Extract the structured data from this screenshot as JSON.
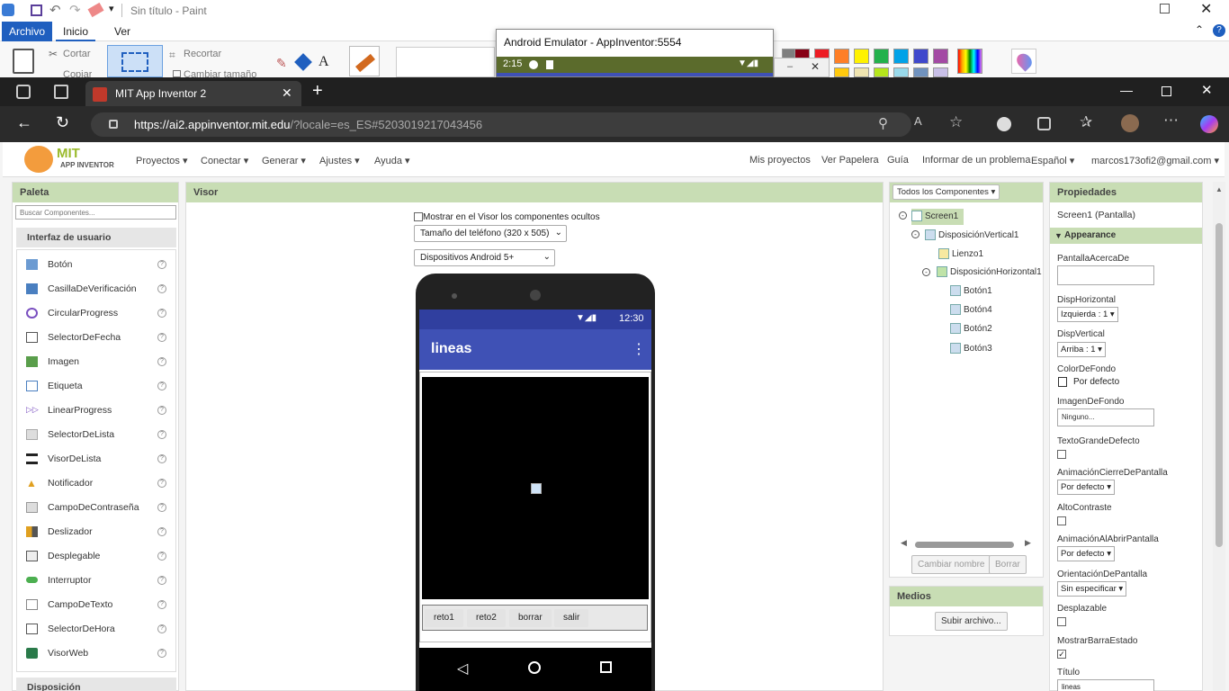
{
  "paint": {
    "title": "Sin título - Paint",
    "tabs": [
      "Archivo",
      "Inicio",
      "Ver"
    ],
    "tools": {
      "cut": "Cortar",
      "copy": "Copiar",
      "crop": "Recortar",
      "resize": "Cambiar tamaño"
    }
  },
  "emulator": {
    "title": "Android Emulator - AppInventor:5554",
    "time": "2:15"
  },
  "browser": {
    "tab_title": "MIT App Inventor 2",
    "url_host": "https://ai2.appinventor.mit.edu",
    "url_rest": "/?locale=es_ES#5203019217043456"
  },
  "nav": {
    "logo_line1": "MIT",
    "logo_line2": "APP INVENTOR",
    "menus": [
      "Proyectos ▾",
      "Conectar ▾",
      "Generar ▾",
      "Ajustes ▾",
      "Ayuda ▾"
    ],
    "right": [
      "Mis proyectos",
      "Ver Papelera",
      "Guía",
      "Informar de un problema",
      "Español ▾",
      "marcos173ofi2@gmail.com ▾"
    ]
  },
  "palette": {
    "title": "Paleta",
    "search_placeholder": "Buscar Componentes...",
    "section": "Interfaz de usuario",
    "items": [
      "Botón",
      "CasillaDeVerificación",
      "CircularProgress",
      "SelectorDeFecha",
      "Imagen",
      "Etiqueta",
      "LinearProgress",
      "SelectorDeLista",
      "VisorDeLista",
      "Notificador",
      "CampoDeContraseña",
      "Deslizador",
      "Desplegable",
      "Interruptor",
      "CampoDeTexto",
      "SelectorDeHora",
      "VisorWeb"
    ],
    "help_glyph": "?",
    "section2": "Disposición"
  },
  "viewer": {
    "title": "Visor",
    "show_hidden": "Mostrar en el Visor los componentes ocultos",
    "phone_size": "Tamaño del teléfono (320 x 505)",
    "android_version": "Dispositivos Android 5+",
    "status_time": "12:30",
    "app_title": "lineas",
    "buttons": [
      "reto1",
      "reto2",
      "borrar",
      "salir"
    ]
  },
  "components": {
    "title": "Todos los Componentes ▾",
    "tree": [
      "Screen1",
      "DisposiciónVertical1",
      "Lienzo1",
      "DisposiciónHorizontal1",
      "Botón1",
      "Botón4",
      "Botón2",
      "Botón3"
    ],
    "rename": "Cambiar nombre",
    "delete": "Borrar",
    "media_title": "Medios",
    "upload": "Subir archivo..."
  },
  "properties": {
    "title": "Propiedades",
    "subject": "Screen1 (Pantalla)",
    "group": "Appearance",
    "about": "PantallaAcercaDe",
    "halign": "DispHorizontal",
    "halign_val": "Izquierda : 1 ▾",
    "valign": "DispVertical",
    "valign_val": "Arriba : 1 ▾",
    "bg": "ColorDeFondo",
    "bg_val": "Por defecto",
    "bgimg": "ImagenDeFondo",
    "bgimg_val": "Ninguno...",
    "bigtext": "TextoGrandeDefecto",
    "close_anim": "AnimaciónCierreDePantalla",
    "close_anim_val": "Por defecto ▾",
    "contrast": "AltoContraste",
    "open_anim": "AnimaciónAlAbrirPantalla",
    "open_anim_val": "Por defecto ▾",
    "orient": "OrientaciónDePantalla",
    "orient_val": "Sin especificar ▾",
    "scroll": "Desplazable",
    "statusbar": "MostrarBarraEstado",
    "title_prop": "Título",
    "title_val": "lineas"
  },
  "colors": {
    "panel_header": "#c8ddb4",
    "app_bar": "#3f51b5",
    "status_bar": "#303f9f"
  }
}
